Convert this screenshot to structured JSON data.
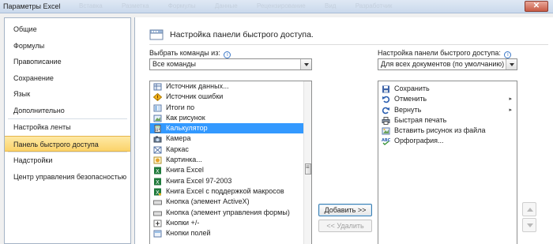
{
  "window": {
    "title": "Параметры Excel",
    "close_glyph": "✕",
    "ghost_tabs": [
      "Вставка",
      "Разметка",
      "Формулы",
      "Данные",
      "Рецензирование",
      "Вид",
      "Разработчик"
    ]
  },
  "sidebar": {
    "items": [
      {
        "label": "Общие"
      },
      {
        "label": "Формулы"
      },
      {
        "label": "Правописание"
      },
      {
        "label": "Сохранение"
      },
      {
        "label": "Язык"
      },
      {
        "label": "Дополнительно"
      },
      {
        "label": "Настройка ленты"
      },
      {
        "label": "Панель быстрого доступа",
        "selected": true
      },
      {
        "label": "Надстройки"
      },
      {
        "label": "Центр управления безопасностью"
      }
    ]
  },
  "main": {
    "header": "Настройка панели быстрого доступа.",
    "choose_label": "Выбрать команды из:",
    "choose_value": "Все команды",
    "customize_label": "Настройка панели быстрого доступа:",
    "customize_value": "Для всех документов (по умолчанию)",
    "info_glyph": "i",
    "commands": [
      {
        "label": "...",
        "icon": "blank-icon"
      },
      {
        "label": "Источник данных...",
        "icon": "data-source-icon"
      },
      {
        "label": "Источник ошибки",
        "icon": "error-source-icon"
      },
      {
        "label": "Итоги по",
        "icon": "sum-icon",
        "submenu": true
      },
      {
        "label": "Как рисунок",
        "icon": "picture-icon",
        "submenu": true
      },
      {
        "label": "Калькулятор",
        "icon": "calculator-icon",
        "selected": true
      },
      {
        "label": "Камера",
        "icon": "camera-icon"
      },
      {
        "label": "Каркас",
        "icon": "wireframe-icon"
      },
      {
        "label": "Картинка...",
        "icon": "clipart-icon"
      },
      {
        "label": "Книга Excel",
        "icon": "excel-book-icon"
      },
      {
        "label": "Книга Excel 97-2003",
        "icon": "excel-book-icon"
      },
      {
        "label": "Книга Excel с поддержкой макросов",
        "icon": "excel-macro-icon"
      },
      {
        "label": "Кнопка (элемент ActiveX)",
        "icon": "button-control-icon"
      },
      {
        "label": "Кнопка (элемент управления формы)",
        "icon": "button-control-icon"
      },
      {
        "label": "Кнопки +/-",
        "icon": "plus-minus-icon"
      },
      {
        "label": "Кнопки полей",
        "icon": "field-buttons-icon"
      }
    ],
    "toolbar_items": [
      {
        "label": "Сохранить",
        "icon": "save-icon"
      },
      {
        "label": "Отменить",
        "icon": "undo-icon",
        "submenu": true
      },
      {
        "label": "Вернуть",
        "icon": "redo-icon",
        "submenu": true
      },
      {
        "label": "Быстрая печать",
        "icon": "quick-print-icon"
      },
      {
        "label": "Вставить рисунок из файла",
        "icon": "insert-picture-icon"
      },
      {
        "label": "Орфография...",
        "icon": "spelling-icon"
      }
    ],
    "add_button": "Добавить >>",
    "remove_button": "<< Удалить",
    "submenu_glyph": "▸"
  }
}
